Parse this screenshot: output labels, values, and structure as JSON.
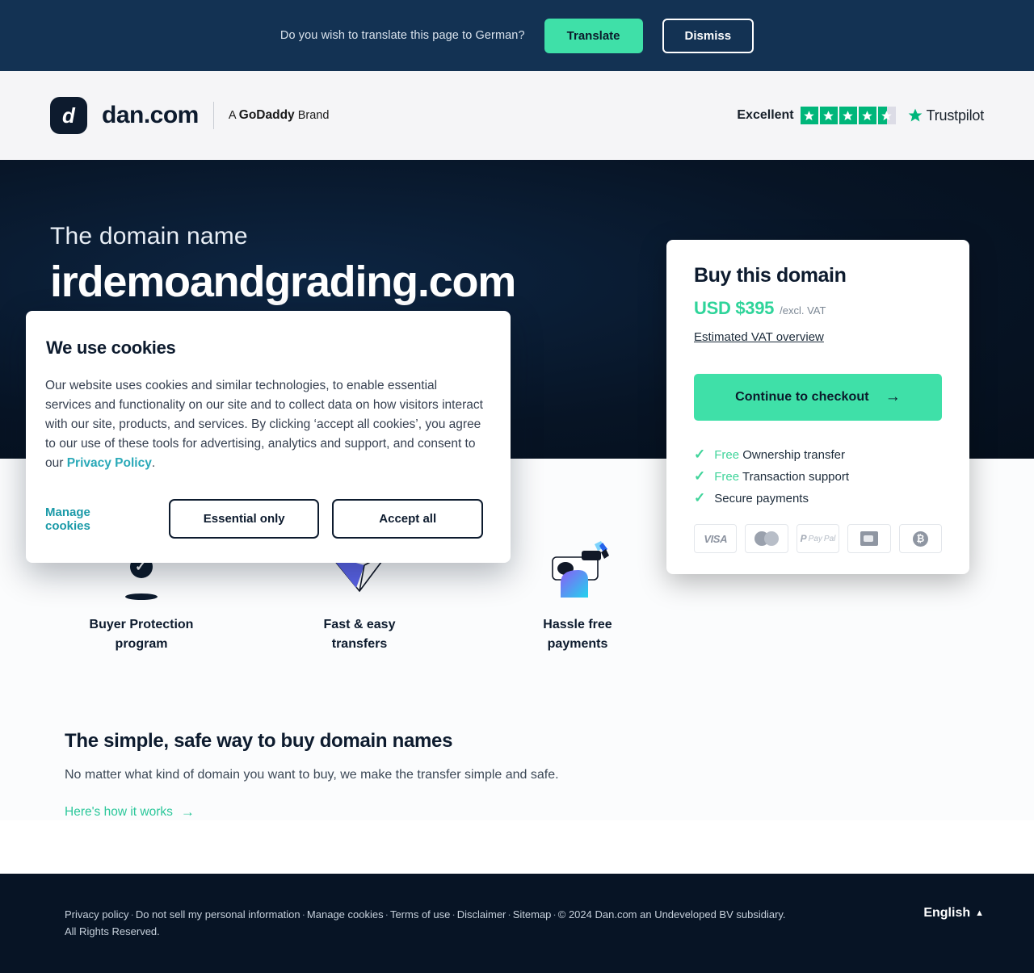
{
  "translate_bar": {
    "message": "Do you wish to translate this page to German?",
    "translate_label": "Translate",
    "dismiss_label": "Dismiss"
  },
  "header": {
    "brand_mark": "d",
    "brand_name": "dan.com",
    "byline_prefix": "A ",
    "byline_brand": "GoDaddy",
    "byline_suffix": " Brand",
    "trustpilot": {
      "rating_word": "Excellent",
      "stars": 4.5,
      "brand": "Trustpilot",
      "star_color": "#00b67a"
    }
  },
  "hero": {
    "eyebrow": "The domain name",
    "domain": "irdemoandgrading.com"
  },
  "buy_card": {
    "title": "Buy this domain",
    "price": "USD $395",
    "price_note": "/excl. VAT",
    "vat_link": "Estimated VAT overview",
    "checkout_label": "Continue to checkout",
    "checkout_arrow": "→",
    "accent_color": "#3fe0a8",
    "benefits": [
      {
        "check": "✓",
        "free": "Free",
        "text": " Ownership transfer"
      },
      {
        "check": "✓",
        "free": "Free",
        "text": " Transaction support"
      },
      {
        "check": "✓",
        "free": "",
        "text": "Secure payments"
      }
    ],
    "payment_methods": [
      "visa-logo",
      "mastercard-logo",
      "paypal-logo",
      "bank-transfer-logo",
      "bitcoin-logo"
    ],
    "visa_text": "VISA",
    "paypal_p": "P",
    "paypal_text": "Pay",
    "paypal_text2": "Pal",
    "bitcoin_glyph": "₿"
  },
  "cookie_dialog": {
    "title": "We use cookies",
    "body_part1": "Our website uses cookies and similar technologies, to enable essential services and functionality on our site and to collect data on how visitors interact with our site, products, and services. By clicking ‘accept all cookies’, you agree to our use of these tools for advertising, analytics and support, and consent to our ",
    "privacy_link": "Privacy Policy",
    "body_part2": ".",
    "manage_label": "Manage cookies",
    "essential_label": "Essential only",
    "accept_label": "Accept all"
  },
  "features": [
    {
      "icon": "shield-check-icon",
      "label_line1": "Buyer Protection",
      "label_line2": "program"
    },
    {
      "icon": "paper-plane-icon",
      "label_line1": "Fast & easy",
      "label_line2": "transfers"
    },
    {
      "icon": "wallet-hand-icon",
      "label_line1": "Hassle free",
      "label_line2": "payments"
    }
  ],
  "info": {
    "heading": "The simple, safe way to buy domain names",
    "paragraph": "No matter what kind of domain you want to buy, we make the transfer simple and safe.",
    "link_label": "Here's how it works",
    "link_arrow": "→"
  },
  "footer": {
    "links": [
      "Privacy policy",
      "Do not sell my personal information",
      "Manage cookies",
      "Terms of use",
      "Disclaimer",
      "Sitemap"
    ],
    "separator": "·",
    "copyright": "© 2024 Dan.com an Undeveloped BV subsidiary. All Rights Reserved.",
    "language": "English",
    "language_carat": "▲"
  }
}
